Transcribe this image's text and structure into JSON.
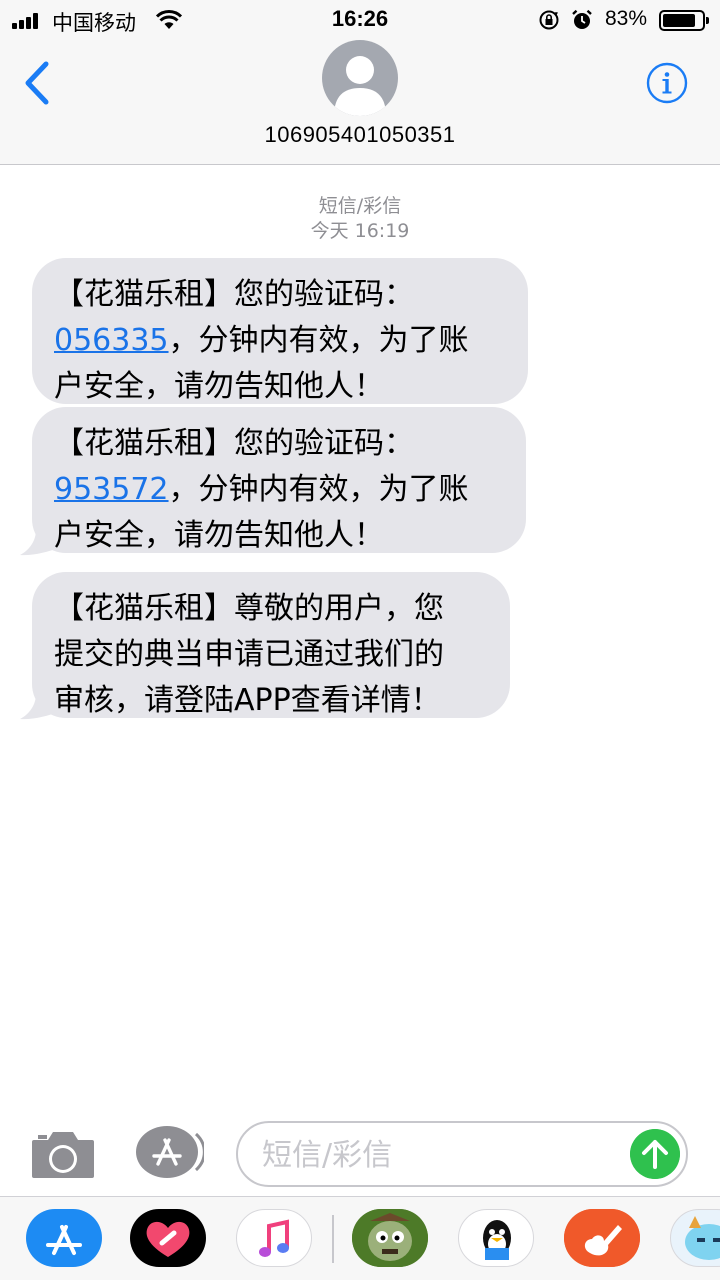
{
  "status_bar": {
    "carrier": "中国移动",
    "time": "16:26",
    "battery_percent": "83%",
    "battery_level": 0.83,
    "signal_bars": 4
  },
  "header": {
    "contact": "106905401050351",
    "back_icon": "chevron-left-icon",
    "info_icon": "info-icon"
  },
  "conversation": {
    "message_type": "短信/彩信",
    "timestamp": "今天 16:19",
    "messages": [
      {
        "code": "056335",
        "lines": [
          "【花猫乐租】您的验证码：",
          "，分钟内有效，为了账",
          "户安全，请勿告知他人！"
        ]
      },
      {
        "code": "953572",
        "lines": [
          "【花猫乐租】您的验证码：",
          "，分钟内有效，为了账",
          "户安全，请勿告知他人！"
        ]
      },
      {
        "lines": [
          "【花猫乐租】尊敬的用户，您",
          "提交的典当申请已通过我们的",
          "审核，请登陆APP查看详情！"
        ]
      }
    ]
  },
  "composer": {
    "placeholder": "短信/彩信",
    "camera_icon": "camera-icon",
    "appstore_icon": "app-store-icon",
    "send_icon": "send-arrow-icon"
  },
  "app_drawer": {
    "apps": [
      "app-store-icon",
      "digital-touch-icon",
      "music-icon",
      "plants-vs-zombies-icon",
      "qq-icon",
      "garageband-icon",
      "game-icon"
    ]
  },
  "colors": {
    "accent": "#1a7cf5",
    "bubble_incoming": "#e5e5ea",
    "link": "#1a73e8",
    "send": "#2fc14e",
    "meta_text": "#8e8e93"
  }
}
